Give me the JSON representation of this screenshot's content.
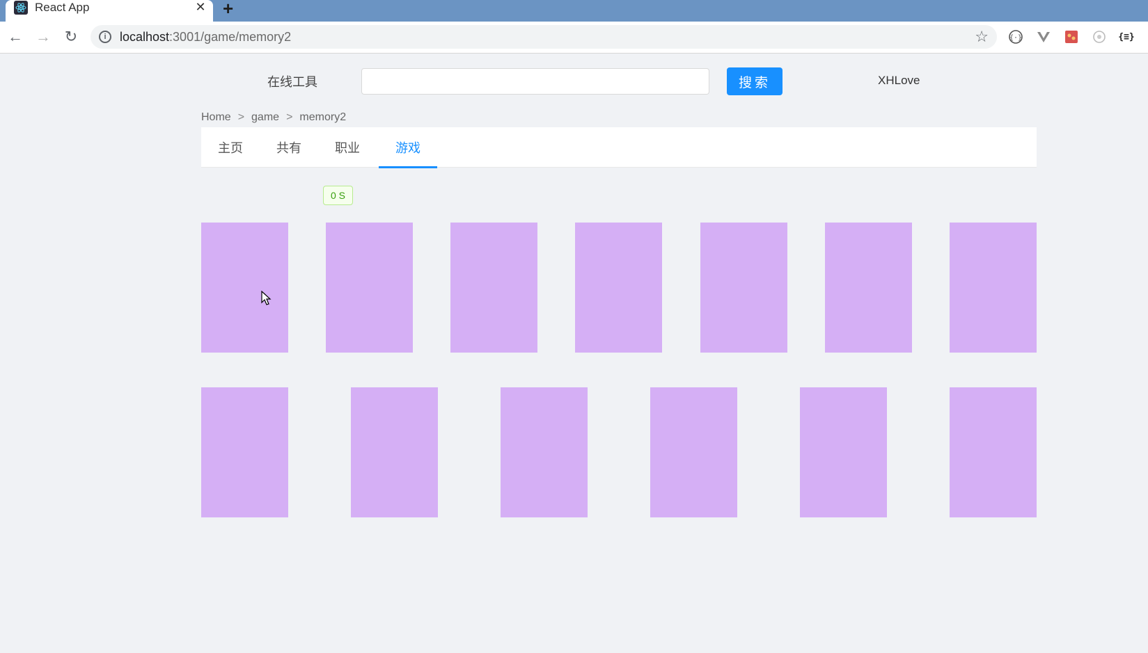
{
  "browser": {
    "tab_title": "React App",
    "tab_close": "✕",
    "new_tab": "+",
    "url_host": "localhost",
    "url_path": ":3001/game/memory2",
    "back": "←",
    "forward": "→",
    "reload": "↻",
    "star": "☆",
    "extensions": [
      "ext-1",
      "ext-2",
      "ext-3",
      "ext-4",
      "ext-5"
    ]
  },
  "header": {
    "site_name": "在线工具",
    "search": {
      "value": "",
      "placeholder": ""
    },
    "search_button": "搜索",
    "user": "XHLove"
  },
  "breadcrumb": [
    "Home",
    ">",
    "game",
    ">",
    "memory2"
  ],
  "nav_tabs": [
    {
      "label": "主页",
      "active": false
    },
    {
      "label": "共有",
      "active": false
    },
    {
      "label": "职业",
      "active": false
    },
    {
      "label": "游戏",
      "active": true
    }
  ],
  "game": {
    "timer": "0 S",
    "card_color": "#d5aff5",
    "rows": [
      7,
      6
    ]
  },
  "colors": {
    "accent": "#1890ff",
    "tab_strip": "#6b94c3",
    "page_bg": "#f0f2f5"
  }
}
